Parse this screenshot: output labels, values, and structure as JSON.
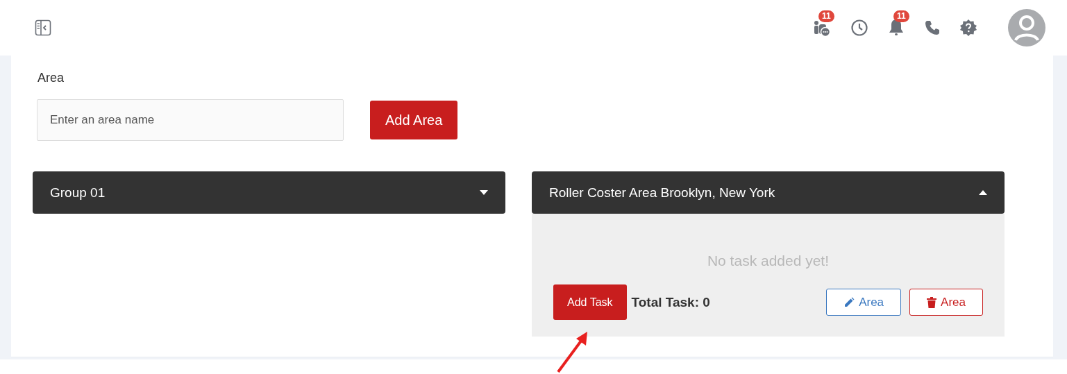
{
  "header": {
    "icons": [
      {
        "kind": "team-chat",
        "badge": "11"
      },
      {
        "kind": "clock"
      },
      {
        "kind": "bell",
        "badge": "11"
      },
      {
        "kind": "phone"
      },
      {
        "kind": "help"
      }
    ]
  },
  "area_form": {
    "label": "Area",
    "placeholder": "Enter an area name",
    "button": "Add Area"
  },
  "groups": [
    {
      "title": "Group 01",
      "expanded": false
    },
    {
      "title": "Roller Coster Area Brooklyn, New York",
      "expanded": true,
      "empty_message": "No task added yet!",
      "add_task": "Add Task",
      "total": "Total Task: 0",
      "edit_button": "Area",
      "delete_button": "Area"
    }
  ]
}
